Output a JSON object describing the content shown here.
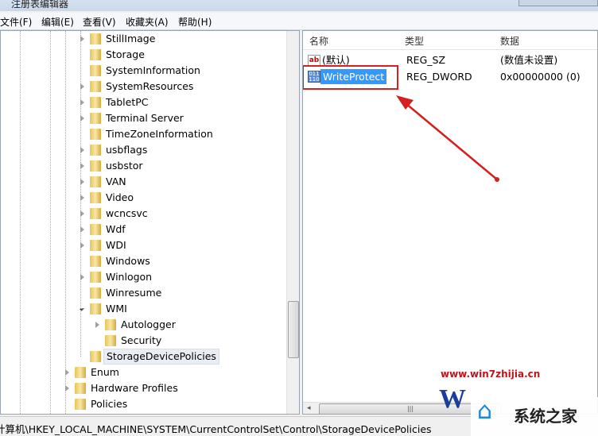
{
  "window": {
    "title": "注册表编辑器"
  },
  "menu": [
    "文件(F)",
    "编辑(E)",
    "查看(V)",
    "收藏夹(A)",
    "帮助(H)"
  ],
  "tree": {
    "items": [
      {
        "label": "StillImage",
        "level": 2,
        "toggle": "collapsed"
      },
      {
        "label": "Storage",
        "level": 2,
        "toggle": "none"
      },
      {
        "label": "SystemInformation",
        "level": 2,
        "toggle": "none"
      },
      {
        "label": "SystemResources",
        "level": 2,
        "toggle": "collapsed"
      },
      {
        "label": "TabletPC",
        "level": 2,
        "toggle": "collapsed"
      },
      {
        "label": "Terminal Server",
        "level": 2,
        "toggle": "collapsed"
      },
      {
        "label": "TimeZoneInformation",
        "level": 2,
        "toggle": "none"
      },
      {
        "label": "usbflags",
        "level": 2,
        "toggle": "collapsed"
      },
      {
        "label": "usbstor",
        "level": 2,
        "toggle": "collapsed"
      },
      {
        "label": "VAN",
        "level": 2,
        "toggle": "collapsed"
      },
      {
        "label": "Video",
        "level": 2,
        "toggle": "collapsed"
      },
      {
        "label": "wcncsvc",
        "level": 2,
        "toggle": "collapsed"
      },
      {
        "label": "Wdf",
        "level": 2,
        "toggle": "collapsed"
      },
      {
        "label": "WDI",
        "level": 2,
        "toggle": "collapsed"
      },
      {
        "label": "Windows",
        "level": 2,
        "toggle": "none"
      },
      {
        "label": "Winlogon",
        "level": 2,
        "toggle": "collapsed"
      },
      {
        "label": "Winresume",
        "level": 2,
        "toggle": "none"
      },
      {
        "label": "WMI",
        "level": 2,
        "toggle": "expanded"
      },
      {
        "label": "Autologger",
        "level": 3,
        "toggle": "collapsed"
      },
      {
        "label": "Security",
        "level": 3,
        "toggle": "none"
      },
      {
        "label": "StorageDevicePolicies",
        "level": 2,
        "toggle": "none",
        "selected": true
      },
      {
        "label": "Enum",
        "level": 1,
        "toggle": "collapsed"
      },
      {
        "label": "Hardware Profiles",
        "level": 1,
        "toggle": "collapsed"
      },
      {
        "label": "Policies",
        "level": 1,
        "toggle": "none"
      }
    ]
  },
  "values": {
    "headers": [
      "名称",
      "类型",
      "数据"
    ],
    "rows": [
      {
        "icon": "string-value-icon",
        "name": "(默认)",
        "type": "REG_SZ",
        "data": "(数值未设置)"
      },
      {
        "icon": "binary-value-icon",
        "name": "WriteProtect",
        "type": "REG_DWORD",
        "data": "0x00000000 (0)",
        "selected": true
      }
    ]
  },
  "status": {
    "path": "计算机\\HKEY_LOCAL_MACHINE\\SYSTEM\\CurrentControlSet\\Control\\StorageDevicePolicies"
  },
  "watermark": {
    "url": "www.win7zhijia.cn",
    "brand": "系统之家"
  },
  "colors": {
    "highlight": "#3399ff",
    "annotation": "#d42020"
  }
}
